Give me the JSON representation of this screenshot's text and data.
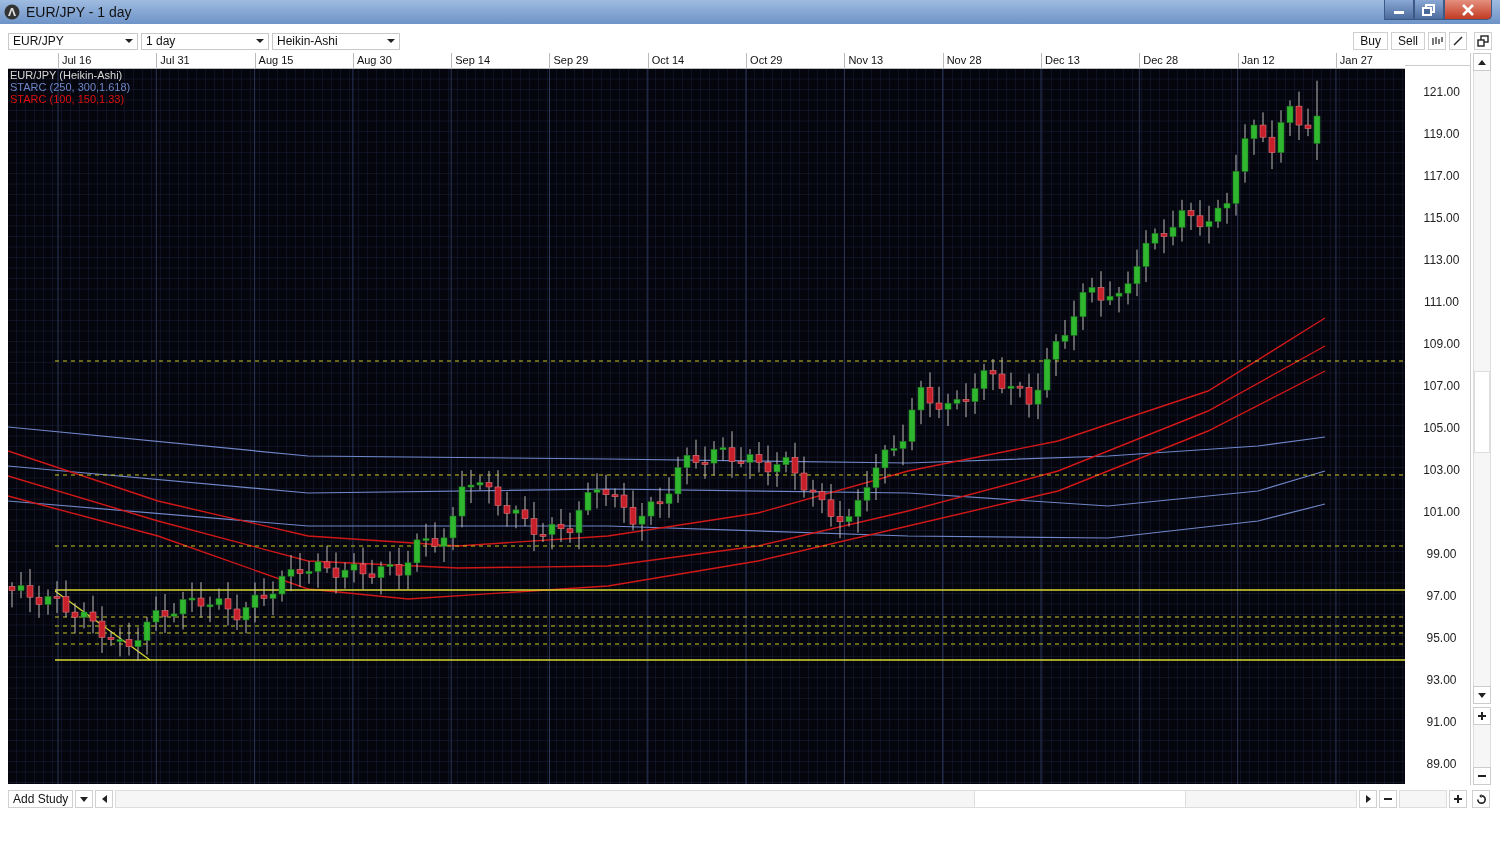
{
  "window": {
    "title": "EUR/JPY - 1 day"
  },
  "toolbar": {
    "symbol": "EUR/JPY",
    "interval": "1 day",
    "chart_type": "Heikin-Ashi",
    "buttons": [
      "Buy",
      "Sell"
    ]
  },
  "date_axis": [
    "Jul 16",
    "Jul 31",
    "Aug 15",
    "Aug 30",
    "Sep 14",
    "Sep 29",
    "Oct 14",
    "Oct 29",
    "Nov 13",
    "Nov 28",
    "Dec 13",
    "Dec 28",
    "Jan 12",
    "Jan 27"
  ],
  "legend": [
    {
      "label": "EUR/JPY (Heikin-Ashi)",
      "color": "#d8d8d8"
    },
    {
      "label": "STARC (250, 300,1.618)",
      "color": "#6f86c8"
    },
    {
      "label": "STARC (100, 150,1.33)",
      "color": "#e01010"
    }
  ],
  "price_axis": [
    "121.00",
    "119.00",
    "117.00",
    "115.00",
    "113.00",
    "111.00",
    "109.00",
    "107.00",
    "105.00",
    "103.00",
    "101.00",
    "99.00",
    "97.00",
    "95.00",
    "93.00",
    "91.00",
    "89.00"
  ],
  "bottom_bar": {
    "add_study": "Add Study"
  }
}
